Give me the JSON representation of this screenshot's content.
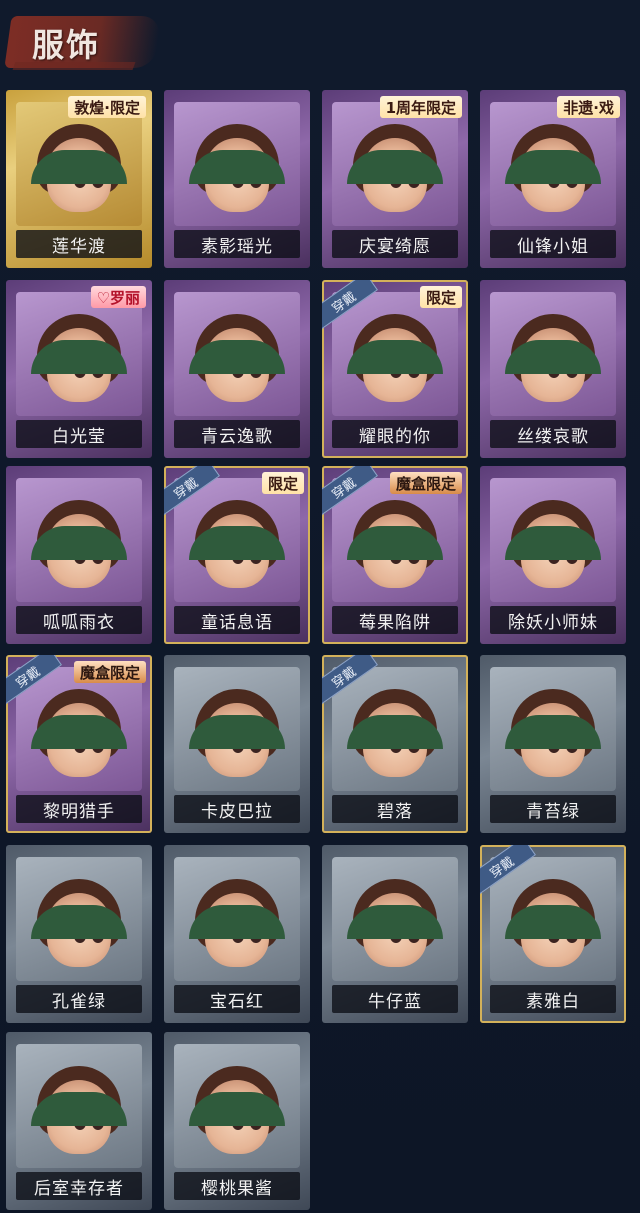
{
  "header": {
    "title": "服饰"
  },
  "cards": [
    {
      "name": "莲华渡",
      "frame": "gold",
      "badge": "敦煌·限定",
      "equipped": false
    },
    {
      "name": "素影瑶光",
      "frame": "purple",
      "badge": "",
      "equipped": false
    },
    {
      "name": "庆宴绮愿",
      "frame": "purple",
      "badge": "1周年限定",
      "equipped": false
    },
    {
      "name": "仙锋小姐",
      "frame": "purple",
      "badge": "非遗·戏",
      "equipped": false
    },
    {
      "name": "白光莹",
      "frame": "purple",
      "badge": "♡罗丽",
      "equipped": false
    },
    {
      "name": "青云逸歌",
      "frame": "purple",
      "badge": "",
      "equipped": false
    },
    {
      "name": "耀眼的你",
      "frame": "purple",
      "badge": "限定",
      "equipped": true
    },
    {
      "name": "丝缕哀歌",
      "frame": "purple",
      "badge": "",
      "equipped": false
    },
    {
      "name": "呱呱雨衣",
      "frame": "purple",
      "badge": "",
      "equipped": false
    },
    {
      "name": "童话息语",
      "frame": "purple",
      "badge": "限定",
      "equipped": true
    },
    {
      "name": "莓果陷阱",
      "frame": "purple",
      "badge": "魔盒限定",
      "equipped": true
    },
    {
      "name": "除妖小师妹",
      "frame": "purple",
      "badge": "",
      "equipped": false
    },
    {
      "name": "黎明猎手",
      "frame": "purple",
      "badge": "魔盒限定",
      "equipped": true
    },
    {
      "name": "卡皮巴拉",
      "frame": "gray",
      "badge": "",
      "equipped": false
    },
    {
      "name": "碧落",
      "frame": "gray",
      "badge": "",
      "equipped": true
    },
    {
      "name": "青苔绿",
      "frame": "gray",
      "badge": "",
      "equipped": false
    },
    {
      "name": "孔雀绿",
      "frame": "gray",
      "badge": "",
      "equipped": false
    },
    {
      "name": "宝石红",
      "frame": "gray",
      "badge": "",
      "equipped": false
    },
    {
      "name": "牛仔蓝",
      "frame": "gray",
      "badge": "",
      "equipped": false
    },
    {
      "name": "素雅白",
      "frame": "gray",
      "badge": "",
      "equipped": true
    },
    {
      "name": "后室幸存者",
      "frame": "gray",
      "badge": "",
      "equipped": false
    },
    {
      "name": "樱桃果酱",
      "frame": "gray",
      "badge": "",
      "equipped": false
    }
  ],
  "equipped_label": "穿戴"
}
